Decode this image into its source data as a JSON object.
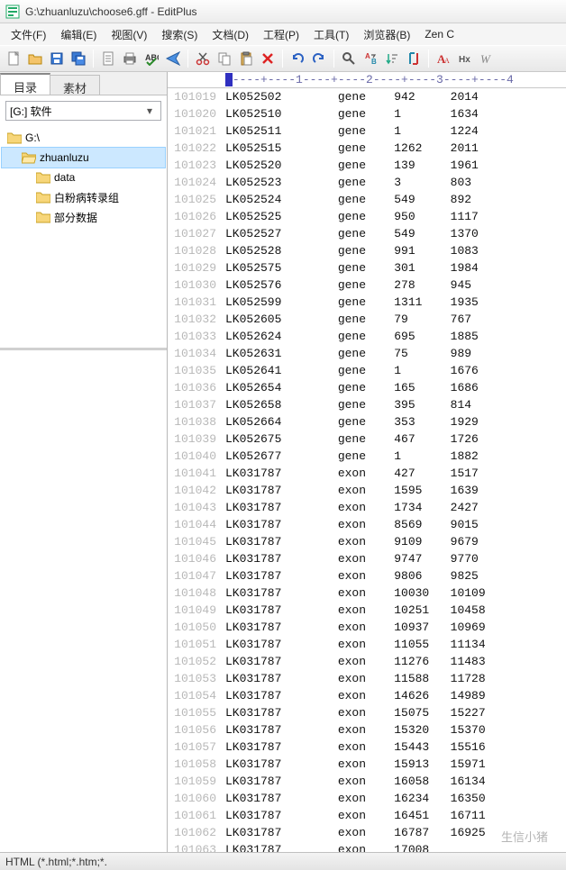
{
  "window": {
    "title": "G:\\zhuanluzu\\choose6.gff - EditPlus"
  },
  "menu": {
    "items": [
      "文件(F)",
      "编辑(E)",
      "视图(V)",
      "搜索(S)",
      "文档(D)",
      "工程(P)",
      "工具(T)",
      "浏览器(B)",
      "Zen C"
    ]
  },
  "toolbar": {
    "icons": [
      "new-file-icon",
      "open-file-icon",
      "save-icon",
      "save-all-icon",
      "sep",
      "doc-icon",
      "print-icon",
      "spellcheck-icon",
      "send-icon",
      "sep",
      "cut-icon",
      "copy-icon",
      "paste-icon",
      "delete-icon",
      "sep",
      "undo-icon",
      "redo-icon",
      "sep",
      "find-icon",
      "replace-icon",
      "sort-icon",
      "columns-icon",
      "sep",
      "font-larger-icon",
      "hex-icon",
      "word-wrap-icon"
    ]
  },
  "sidebar": {
    "tabs": [
      "目录",
      "素材"
    ],
    "activeTab": 0,
    "drive": "[G:] 软件",
    "tree": [
      {
        "label": "G:\\",
        "indent": 0,
        "selected": false
      },
      {
        "label": "zhuanluzu",
        "indent": 1,
        "selected": true
      },
      {
        "label": "data",
        "indent": 2,
        "selected": false
      },
      {
        "label": "白粉病转录组",
        "indent": 2,
        "selected": false
      },
      {
        "label": "部分数据",
        "indent": 2,
        "selected": false
      }
    ]
  },
  "ruler": "----+----1----+----2----+----3----+----4",
  "rows": [
    {
      "n": "101019",
      "c1": "LK052502",
      "c2": "gene",
      "c3": "942",
      "c4": "2014"
    },
    {
      "n": "101020",
      "c1": "LK052510",
      "c2": "gene",
      "c3": "1",
      "c4": "1634"
    },
    {
      "n": "101021",
      "c1": "LK052511",
      "c2": "gene",
      "c3": "1",
      "c4": "1224"
    },
    {
      "n": "101022",
      "c1": "LK052515",
      "c2": "gene",
      "c3": "1262",
      "c4": "2011"
    },
    {
      "n": "101023",
      "c1": "LK052520",
      "c2": "gene",
      "c3": "139",
      "c4": "1961"
    },
    {
      "n": "101024",
      "c1": "LK052523",
      "c2": "gene",
      "c3": "3",
      "c4": "803"
    },
    {
      "n": "101025",
      "c1": "LK052524",
      "c2": "gene",
      "c3": "549",
      "c4": "892"
    },
    {
      "n": "101026",
      "c1": "LK052525",
      "c2": "gene",
      "c3": "950",
      "c4": "1117"
    },
    {
      "n": "101027",
      "c1": "LK052527",
      "c2": "gene",
      "c3": "549",
      "c4": "1370"
    },
    {
      "n": "101028",
      "c1": "LK052528",
      "c2": "gene",
      "c3": "991",
      "c4": "1083"
    },
    {
      "n": "101029",
      "c1": "LK052575",
      "c2": "gene",
      "c3": "301",
      "c4": "1984"
    },
    {
      "n": "101030",
      "c1": "LK052576",
      "c2": "gene",
      "c3": "278",
      "c4": "945"
    },
    {
      "n": "101031",
      "c1": "LK052599",
      "c2": "gene",
      "c3": "1311",
      "c4": "1935"
    },
    {
      "n": "101032",
      "c1": "LK052605",
      "c2": "gene",
      "c3": "79",
      "c4": "767"
    },
    {
      "n": "101033",
      "c1": "LK052624",
      "c2": "gene",
      "c3": "695",
      "c4": "1885"
    },
    {
      "n": "101034",
      "c1": "LK052631",
      "c2": "gene",
      "c3": "75",
      "c4": "989"
    },
    {
      "n": "101035",
      "c1": "LK052641",
      "c2": "gene",
      "c3": "1",
      "c4": "1676"
    },
    {
      "n": "101036",
      "c1": "LK052654",
      "c2": "gene",
      "c3": "165",
      "c4": "1686"
    },
    {
      "n": "101037",
      "c1": "LK052658",
      "c2": "gene",
      "c3": "395",
      "c4": "814"
    },
    {
      "n": "101038",
      "c1": "LK052664",
      "c2": "gene",
      "c3": "353",
      "c4": "1929"
    },
    {
      "n": "101039",
      "c1": "LK052675",
      "c2": "gene",
      "c3": "467",
      "c4": "1726"
    },
    {
      "n": "101040",
      "c1": "LK052677",
      "c2": "gene",
      "c3": "1",
      "c4": "1882"
    },
    {
      "n": "101041",
      "c1": "LK031787",
      "c2": "exon",
      "c3": "427",
      "c4": "1517"
    },
    {
      "n": "101042",
      "c1": "LK031787",
      "c2": "exon",
      "c3": "1595",
      "c4": "1639"
    },
    {
      "n": "101043",
      "c1": "LK031787",
      "c2": "exon",
      "c3": "1734",
      "c4": "2427"
    },
    {
      "n": "101044",
      "c1": "LK031787",
      "c2": "exon",
      "c3": "8569",
      "c4": "9015"
    },
    {
      "n": "101045",
      "c1": "LK031787",
      "c2": "exon",
      "c3": "9109",
      "c4": "9679"
    },
    {
      "n": "101046",
      "c1": "LK031787",
      "c2": "exon",
      "c3": "9747",
      "c4": "9770"
    },
    {
      "n": "101047",
      "c1": "LK031787",
      "c2": "exon",
      "c3": "9806",
      "c4": "9825"
    },
    {
      "n": "101048",
      "c1": "LK031787",
      "c2": "exon",
      "c3": "10030",
      "c4": "10109"
    },
    {
      "n": "101049",
      "c1": "LK031787",
      "c2": "exon",
      "c3": "10251",
      "c4": "10458"
    },
    {
      "n": "101050",
      "c1": "LK031787",
      "c2": "exon",
      "c3": "10937",
      "c4": "10969"
    },
    {
      "n": "101051",
      "c1": "LK031787",
      "c2": "exon",
      "c3": "11055",
      "c4": "11134"
    },
    {
      "n": "101052",
      "c1": "LK031787",
      "c2": "exon",
      "c3": "11276",
      "c4": "11483"
    },
    {
      "n": "101053",
      "c1": "LK031787",
      "c2": "exon",
      "c3": "11588",
      "c4": "11728"
    },
    {
      "n": "101054",
      "c1": "LK031787",
      "c2": "exon",
      "c3": "14626",
      "c4": "14989"
    },
    {
      "n": "101055",
      "c1": "LK031787",
      "c2": "exon",
      "c3": "15075",
      "c4": "15227"
    },
    {
      "n": "101056",
      "c1": "LK031787",
      "c2": "exon",
      "c3": "15320",
      "c4": "15370"
    },
    {
      "n": "101057",
      "c1": "LK031787",
      "c2": "exon",
      "c3": "15443",
      "c4": "15516"
    },
    {
      "n": "101058",
      "c1": "LK031787",
      "c2": "exon",
      "c3": "15913",
      "c4": "15971"
    },
    {
      "n": "101059",
      "c1": "LK031787",
      "c2": "exon",
      "c3": "16058",
      "c4": "16134"
    },
    {
      "n": "101060",
      "c1": "LK031787",
      "c2": "exon",
      "c3": "16234",
      "c4": "16350"
    },
    {
      "n": "101061",
      "c1": "LK031787",
      "c2": "exon",
      "c3": "16451",
      "c4": "16711"
    },
    {
      "n": "101062",
      "c1": "LK031787",
      "c2": "exon",
      "c3": "16787",
      "c4": "16925"
    },
    {
      "n": "101063",
      "c1": "LK031787",
      "c2": "exon",
      "c3": "17008",
      "c4": ""
    }
  ],
  "status": {
    "filter": "HTML (*.html;*.htm;*."
  },
  "watermark": "生信小猪"
}
